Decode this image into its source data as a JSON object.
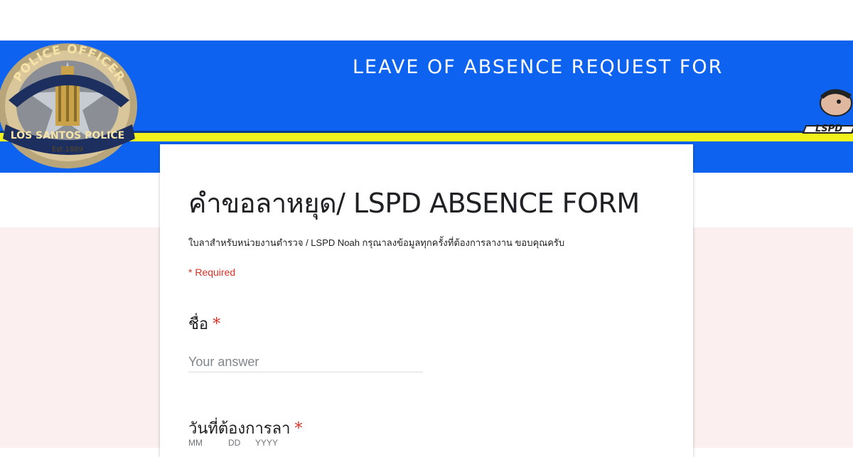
{
  "banner": {
    "title": "LEAVE OF ABSENCE REQUEST FOR",
    "badge_top_text": "POLICE OFFICER",
    "badge_bottom_text": "LOS SANTOS POLICE",
    "badge_est_text": "Est.1889",
    "mascot_text": "LSPD",
    "colors": {
      "background": "#0d63f0",
      "stripe": "#f2f21c"
    }
  },
  "form": {
    "title": "คำขอลาหยุด/ LSPD ABSENCE FORM",
    "description": "ใบลาสำหรับหน่วยงานตำรวจ / LSPD Noah กรุณาลงข้อมูลทุกครั้งที่ต้องการลางาน ขอบคุณครับ",
    "required_note": "* Required",
    "questions": [
      {
        "label": "ชื่อ",
        "required_mark": "*",
        "placeholder": "Your answer"
      },
      {
        "label": "วันที่ต้องการลา",
        "required_mark": "*",
        "date_parts": [
          "MM",
          "DD",
          "YYYY"
        ]
      }
    ]
  },
  "colors": {
    "required": "#d93025",
    "lower_background": "#fbf0ef"
  }
}
